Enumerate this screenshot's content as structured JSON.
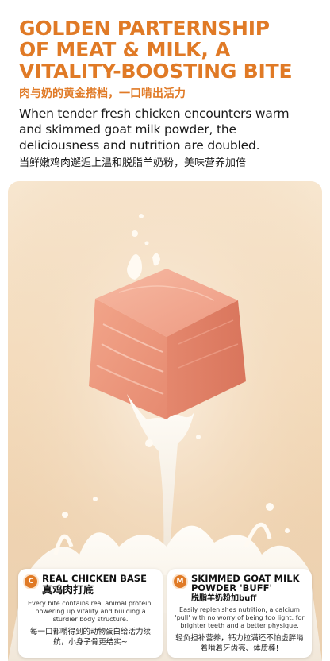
{
  "header": {
    "headline_lines": [
      "GOLDEN PARTERNSHIP",
      "OF MEAT & MILK, A",
      "VITALITY-BOOSTING BITE"
    ],
    "subtitle_cn": "肉与奶的黄金搭档，一口啃出活力",
    "description_en": "When tender fresh chicken encounters warm and skimmed goat milk powder, the deliciousness and nutrition are doubled.",
    "description_cn": "当鲜嫩鸡肉邂逅上温和脱脂羊奶粉，美味营养加倍"
  },
  "cards": [
    {
      "badge": "C",
      "title_en": "REAL CHICKEN BASE",
      "title_cn": "真鸡肉打底",
      "body_en": "Every bite contains real animal protein, powering up vitality and building a sturdier body structure.",
      "body_cn": "每一口都嚼得到的动物蛋白给活力续航，小身子骨更结实~"
    },
    {
      "badge": "M",
      "title_en": "SKIMMED GOAT MILK POWDER 'BUFF'",
      "title_cn": "脱脂羊奶粉加buff",
      "body_en": "Easily replenishes nutrition, a calcium 'pull' with no worry of being too light, for brighter teeth and a better physique.",
      "body_cn": "轻负担补营养，钙力拉满还不怕虚胖啃着啃着牙齿亮、体质棒!"
    }
  ],
  "colors": {
    "accent": "#e07a26",
    "text": "#1a1a1a",
    "photo_bg": "#f4dcbd"
  }
}
